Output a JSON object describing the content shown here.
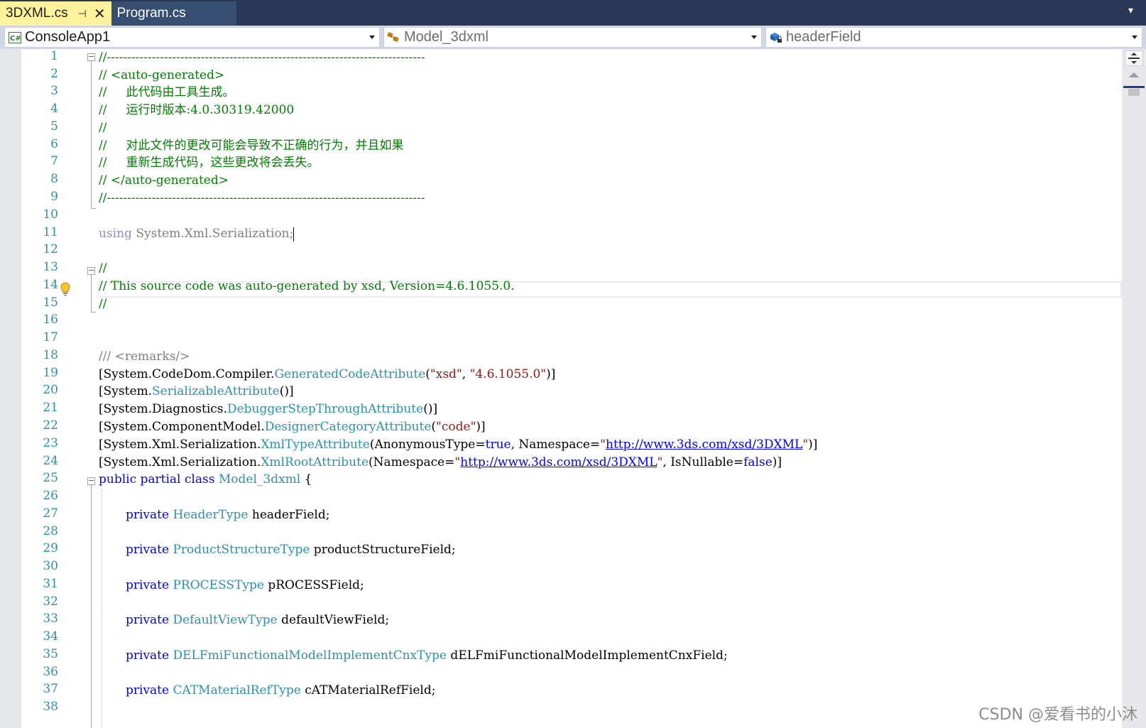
{
  "tabs": [
    {
      "label": "3DXML.cs",
      "active": true,
      "pinned": true
    },
    {
      "label": "Program.cs",
      "active": false
    }
  ],
  "navbar": {
    "project": "ConsoleApp1",
    "type": "Model_3dxml",
    "member": "headerField"
  },
  "editor": {
    "line_numbers": [
      "1",
      "2",
      "3",
      "4",
      "5",
      "6",
      "7",
      "8",
      "9",
      "10",
      "11",
      "12",
      "13",
      "14",
      "15",
      "16",
      "17",
      "18",
      "19",
      "20",
      "21",
      "22",
      "23",
      "24",
      "25",
      "26",
      "27",
      "28",
      "29",
      "30",
      "31",
      "32",
      "33",
      "34",
      "35",
      "36",
      "37",
      "38"
    ],
    "lines": {
      "l1": "//------------------------------------------------------------------------------",
      "l2": "// <auto-generated>",
      "l3": "//     此代码由工具生成。",
      "l4": "//     运行时版本:4.0.30319.42000",
      "l5": "//",
      "l6": "//     对此文件的更改可能会导致不正确的行为，并且如果",
      "l7": "//     重新生成代码，这些更改将会丢失。",
      "l8": "// </auto-generated>",
      "l9": "//------------------------------------------------------------------------------",
      "l11_kw": "using",
      "l11_rest": " System.Xml.Serialization;",
      "l13": "//",
      "l14": "// This source code was auto-generated by xsd, Version=4.6.1055.0.",
      "l15": "//",
      "l18": "/// <remarks/>",
      "l19_a": "[System.CodeDom.Compiler.",
      "l19_b": "GeneratedCodeAttribute",
      "l19_c": "(",
      "l19_d": "\"xsd\"",
      "l19_e": ", ",
      "l19_f": "\"4.6.1055.0\"",
      "l19_g": ")]",
      "l20_a": "[System.",
      "l20_b": "SerializableAttribute",
      "l20_c": "()]",
      "l21_a": "[System.Diagnostics.",
      "l21_b": "DebuggerStepThroughAttribute",
      "l21_c": "()]",
      "l22_a": "[System.ComponentModel.",
      "l22_b": "DesignerCategoryAttribute",
      "l22_c": "(",
      "l22_d": "\"code\"",
      "l22_e": ")]",
      "l23_a": "[System.Xml.Serialization.",
      "l23_b": "XmlTypeAttribute",
      "l23_c": "(AnonymousType=",
      "l23_d": "true",
      "l23_e": ", Namespace=",
      "l23_f": "\"",
      "l23_g": "http://www.3ds.com/xsd/3DXML",
      "l23_h": "\"",
      "l23_i": ")]",
      "l24_a": "[System.Xml.Serialization.",
      "l24_b": "XmlRootAttribute",
      "l24_c": "(Namespace=",
      "l24_d": "\"",
      "l24_e": "http://www.3ds.com/xsd/3DXML",
      "l24_f": "\"",
      "l24_g": ", IsNullable=",
      "l24_h": "false",
      "l24_i": ")]",
      "l25_a": "public partial class",
      "l25_b": " Model_3dxml",
      "l25_c": " {",
      "private": "private",
      "l27_t": "HeaderType",
      "l27_n": " headerField;",
      "l29_t": "ProductStructureType",
      "l29_n": " productStructureField;",
      "l31_t": "PROCESSType",
      "l31_n": " pROCESSField;",
      "l33_t": "DefaultViewType",
      "l33_n": " defaultViewField;",
      "l35_t": "DELFmiFunctionalModelImplementCnxType",
      "l35_n": " dELFmiFunctionalModelImplementCnxField;",
      "l37_t": "CATMaterialRefType",
      "l37_n": " cATMaterialRefField;"
    }
  },
  "watermark": "CSDN @爱看书的小沐",
  "colors": {
    "tabbar": "#293955",
    "active_tab": "#fff29d",
    "comment": "#008000",
    "keyword": "#0000ff",
    "type": "#2b91af",
    "string": "#a31515",
    "line_number": "#2b91af"
  }
}
